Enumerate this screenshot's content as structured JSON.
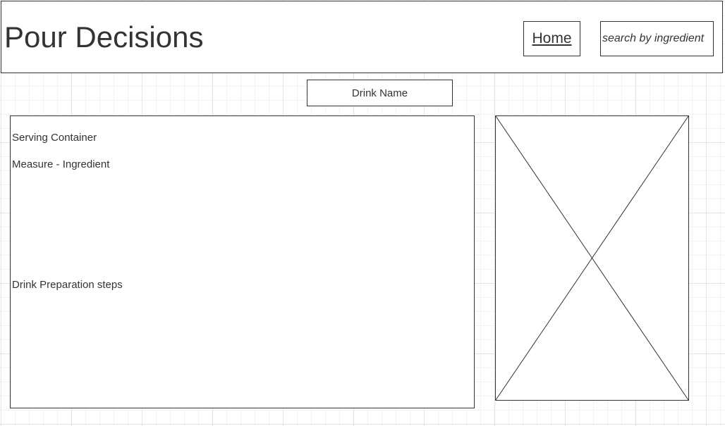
{
  "header": {
    "title": "Pour Decisions",
    "home_label": "Home",
    "search_placeholder": "search by ingredient"
  },
  "drink": {
    "name_label": "Drink Name"
  },
  "recipe": {
    "serving_container": "Serving Container",
    "measure_ingredient": "Measure - Ingredient",
    "preparation_steps": "Drink Preparation steps"
  },
  "image": {
    "icon": "image-placeholder-icon"
  },
  "colors": {
    "line": "#333333",
    "grid": "#e3e3e3",
    "background": "#ffffff"
  }
}
